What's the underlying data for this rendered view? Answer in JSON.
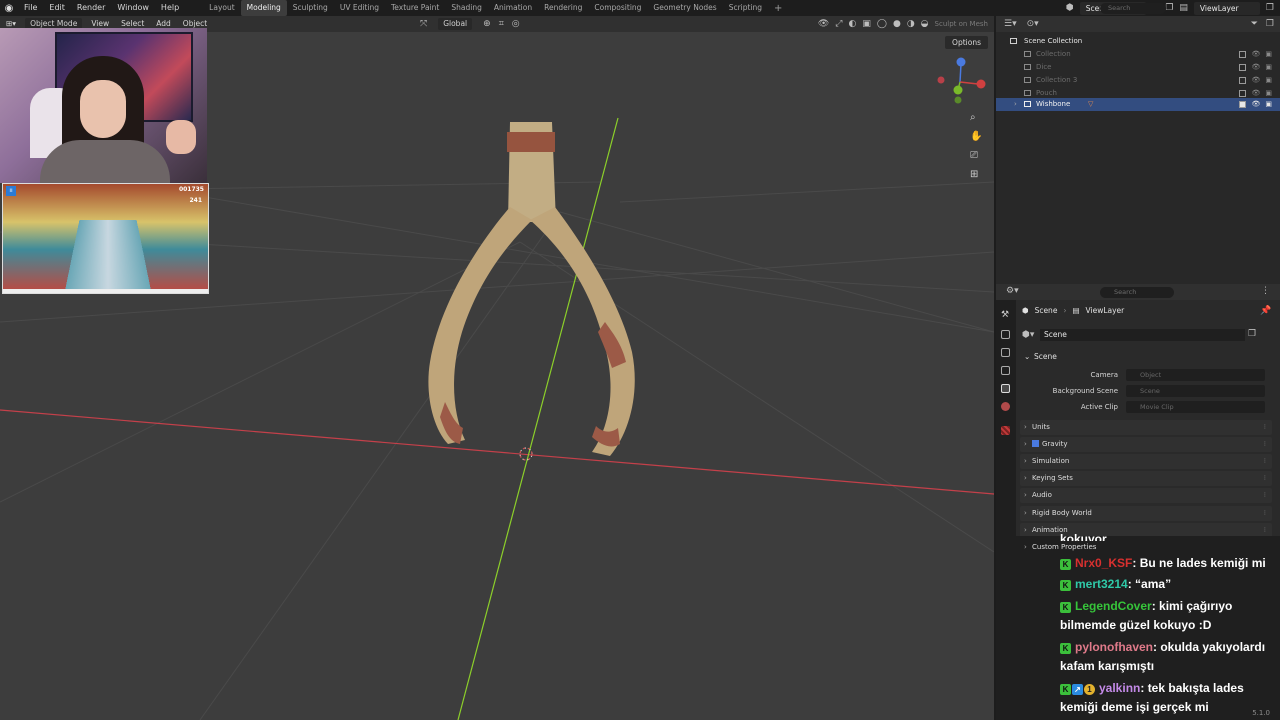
{
  "topbar": {
    "menus": [
      "File",
      "Edit",
      "Render",
      "Window",
      "Help"
    ],
    "workspace_tabs": [
      "Layout",
      "Modeling",
      "Sculpting",
      "UV Editing",
      "Texture Paint",
      "Shading",
      "Animation",
      "Rendering",
      "Compositing",
      "Geometry Nodes",
      "Scripting"
    ],
    "active_tab": "Modeling",
    "scene": "Scene",
    "view_layer": "ViewLayer"
  },
  "viewport_header": {
    "mode": "Object Mode",
    "menus": [
      "View",
      "Select",
      "Add",
      "Object"
    ],
    "orientation": "Global",
    "sculpt_label": "Sculpt on Mesh",
    "options_label": "Options"
  },
  "game_hud": {
    "score": "001735",
    "coins": "241"
  },
  "outliner": {
    "search_placeholder": "Search",
    "root": "Scene Collection",
    "items": [
      {
        "label": "Collection",
        "selected": false
      },
      {
        "label": "Dice",
        "selected": false
      },
      {
        "label": "Collection 3",
        "selected": false
      },
      {
        "label": "Pouch",
        "selected": false
      },
      {
        "label": "Wishbone",
        "selected": true
      }
    ]
  },
  "properties": {
    "search_placeholder": "Search",
    "breadcrumb": [
      "Scene",
      "ViewLayer"
    ],
    "scene_name": "Scene",
    "panel_title": "Scene",
    "rows": [
      {
        "label": "Camera",
        "placeholder": "Object"
      },
      {
        "label": "Background Scene",
        "placeholder": "Scene"
      },
      {
        "label": "Active Clip",
        "placeholder": "Movie Clip"
      }
    ],
    "sections": [
      "Units",
      "Gravity",
      "Simulation",
      "Keying Sets",
      "Audio",
      "Rigid Body World",
      "Animation",
      "Custom Properties"
    ]
  },
  "chat": {
    "cut_text": "kokuyor",
    "messages": [
      {
        "user": "Nrx0_KSF",
        "color": "#d8302f",
        "text": ": Bu ne lades kemiği mi",
        "badges": [
          "K"
        ]
      },
      {
        "user": "mert3214",
        "color": "#2fc9a8",
        "text": ": “ama”",
        "badges": [
          "K"
        ]
      },
      {
        "user": "LegendCover",
        "color": "#36c43a",
        "text": ": kimi çağırıyo bilmemde güzel kokuyo :D",
        "badges": [
          "K"
        ]
      },
      {
        "user": "pylonofhaven",
        "color": "#e07a8a",
        "text": ": okulda yakıyolardı kafam karışmıştı",
        "badges": [
          "K"
        ]
      },
      {
        "user": "yalkinn",
        "color": "#c48ae8",
        "text": ": tek bakışta lades kemiği deme işi gerçek mi",
        "badges": [
          "K",
          "↗",
          "1"
        ]
      }
    ]
  },
  "version": "5.1.0",
  "colors": {
    "accent": "#334d80",
    "viewport_bg": "#3d3d3d",
    "x_axis": "#c4404a",
    "y_axis": "#8ccf2a"
  }
}
